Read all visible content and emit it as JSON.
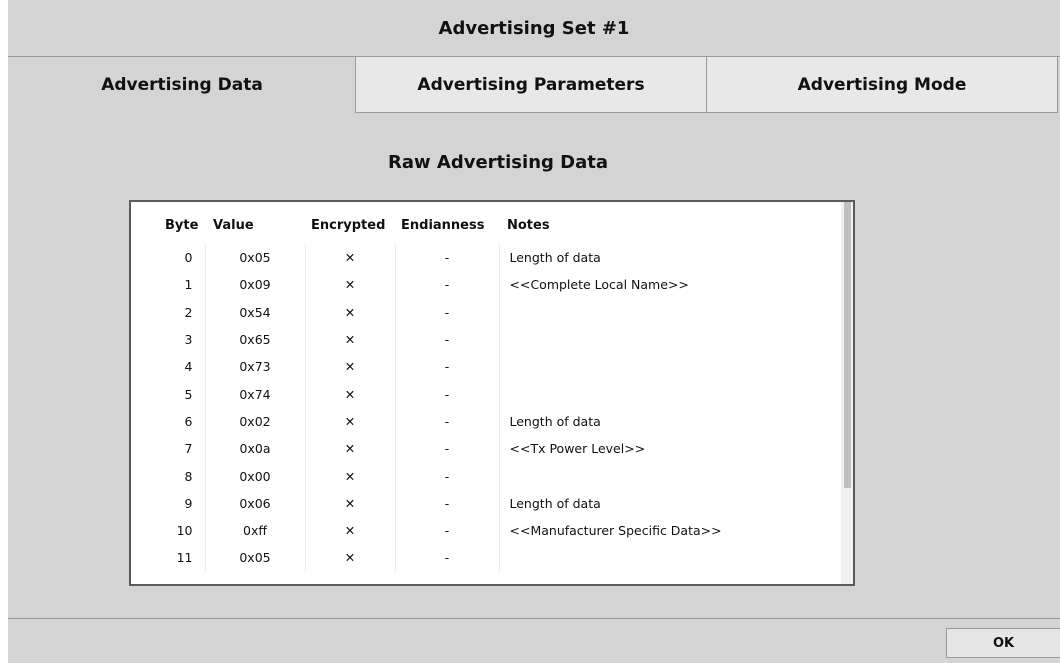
{
  "dialog": {
    "title": "Advertising Set #1",
    "ok_label": "OK"
  },
  "tabs": [
    {
      "label": "Advertising Data",
      "active": true
    },
    {
      "label": "Advertising Parameters",
      "active": false
    },
    {
      "label": "Advertising Mode",
      "active": false
    }
  ],
  "section": {
    "title": "Raw Advertising Data"
  },
  "table": {
    "columns": [
      "Byte",
      "Value",
      "Encrypted",
      "Endianness",
      "Notes"
    ],
    "rows": [
      {
        "byte": "0",
        "value": "0x05",
        "encrypted": "✕",
        "endianness": "-",
        "notes": "Length of data"
      },
      {
        "byte": "1",
        "value": "0x09",
        "encrypted": "✕",
        "endianness": "-",
        "notes": "<<Complete Local Name>>"
      },
      {
        "byte": "2",
        "value": "0x54",
        "encrypted": "✕",
        "endianness": "-",
        "notes": ""
      },
      {
        "byte": "3",
        "value": "0x65",
        "encrypted": "✕",
        "endianness": "-",
        "notes": ""
      },
      {
        "byte": "4",
        "value": "0x73",
        "encrypted": "✕",
        "endianness": "-",
        "notes": ""
      },
      {
        "byte": "5",
        "value": "0x74",
        "encrypted": "✕",
        "endianness": "-",
        "notes": ""
      },
      {
        "byte": "6",
        "value": "0x02",
        "encrypted": "✕",
        "endianness": "-",
        "notes": "Length of data"
      },
      {
        "byte": "7",
        "value": "0x0a",
        "encrypted": "✕",
        "endianness": "-",
        "notes": "<<Tx Power Level>>"
      },
      {
        "byte": "8",
        "value": "0x00",
        "encrypted": "✕",
        "endianness": "-",
        "notes": ""
      },
      {
        "byte": "9",
        "value": "0x06",
        "encrypted": "✕",
        "endianness": "-",
        "notes": "Length of data"
      },
      {
        "byte": "10",
        "value": "0xff",
        "encrypted": "✕",
        "endianness": "-",
        "notes": "<<Manufacturer Specific Data>>"
      },
      {
        "byte": "11",
        "value": "0x05",
        "encrypted": "✕",
        "endianness": "-",
        "notes": ""
      }
    ]
  }
}
